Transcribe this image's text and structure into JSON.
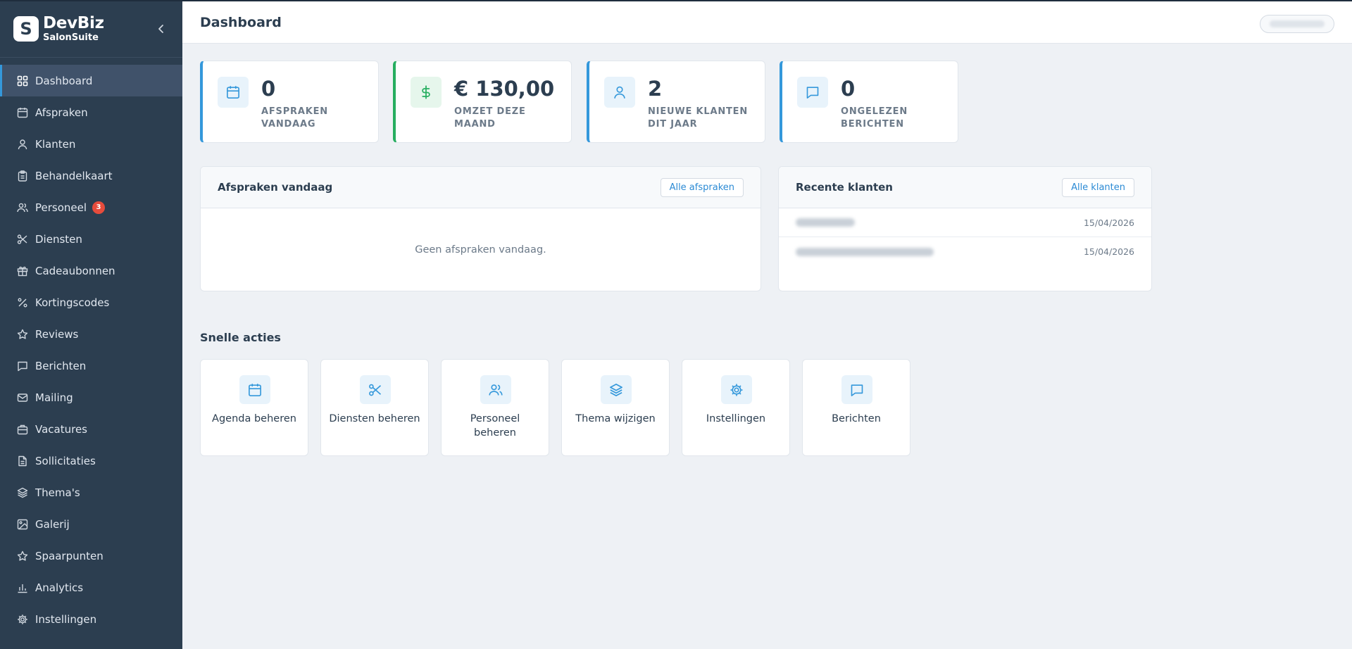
{
  "brand": {
    "logo_letter": "S",
    "title": "DevBiz",
    "subtitle": "SalonSuite"
  },
  "sidebar": {
    "items": [
      {
        "label": "Dashboard",
        "icon": "grid-icon",
        "active": true
      },
      {
        "label": "Afspraken",
        "icon": "calendar-icon"
      },
      {
        "label": "Klanten",
        "icon": "user-icon"
      },
      {
        "label": "Behandelkaart",
        "icon": "clipboard-icon"
      },
      {
        "label": "Personeel",
        "icon": "users-icon",
        "badge": "3"
      },
      {
        "label": "Diensten",
        "icon": "scissors-icon"
      },
      {
        "label": "Cadeaubonnen",
        "icon": "gift-icon"
      },
      {
        "label": "Kortingscodes",
        "icon": "percent-icon"
      },
      {
        "label": "Reviews",
        "icon": "star-icon"
      },
      {
        "label": "Berichten",
        "icon": "message-icon"
      },
      {
        "label": "Mailing",
        "icon": "mail-icon"
      },
      {
        "label": "Vacatures",
        "icon": "briefcase-icon"
      },
      {
        "label": "Sollicitaties",
        "icon": "file-icon"
      },
      {
        "label": "Thema's",
        "icon": "layers-icon"
      },
      {
        "label": "Galerij",
        "icon": "image-icon"
      },
      {
        "label": "Spaarpunten",
        "icon": "star-outline-icon"
      },
      {
        "label": "Analytics",
        "icon": "bar-chart-icon"
      },
      {
        "label": "Instellingen",
        "icon": "gear-icon"
      }
    ]
  },
  "header": {
    "title": "Dashboard"
  },
  "stats": [
    {
      "value": "0",
      "label": "AFSPRAKEN VANDAAG",
      "icon": "calendar-icon",
      "accent": "#3498db"
    },
    {
      "value": "€ 130,00",
      "label": "OMZET DEZE MAAND",
      "icon": "dollar-icon",
      "accent": "#27ae60"
    },
    {
      "value": "2",
      "label": "NIEUWE KLANTEN DIT JAAR",
      "icon": "user-icon",
      "accent": "#3498db"
    },
    {
      "value": "0",
      "label": "ONGELEZEN BERICHTEN",
      "icon": "message-icon",
      "accent": "#3498db"
    }
  ],
  "appointments_panel": {
    "title": "Afspraken vandaag",
    "button": "Alle afspraken",
    "empty": "Geen afspraken vandaag."
  },
  "clients_panel": {
    "title": "Recente klanten",
    "button": "Alle klanten",
    "rows": [
      {
        "date": "15/04/2026"
      },
      {
        "date": "15/04/2026"
      }
    ]
  },
  "quick_actions": {
    "title": "Snelle acties",
    "items": [
      {
        "label": "Agenda beheren",
        "icon": "calendar-icon"
      },
      {
        "label": "Diensten beheren",
        "icon": "scissors-icon"
      },
      {
        "label": "Personeel beheren",
        "icon": "users-icon"
      },
      {
        "label": "Thema wijzigen",
        "icon": "layers-icon"
      },
      {
        "label": "Instellingen",
        "icon": "gear-icon"
      },
      {
        "label": "Berichten",
        "icon": "message-icon"
      }
    ]
  },
  "colors": {
    "sidebar_bg": "#2c3e50",
    "accent_blue": "#3498db",
    "accent_green": "#27ae60",
    "badge_red": "#e74c3c"
  }
}
